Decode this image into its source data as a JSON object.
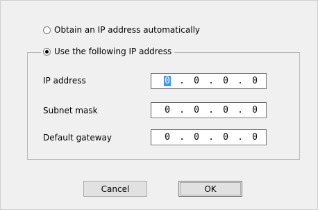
{
  "auto_option": {
    "label": "Obtain an IP address automatically",
    "selected": false
  },
  "manual_option": {
    "label": "Use the following IP address",
    "selected": true
  },
  "fields": {
    "ip_address": {
      "label": "IP address",
      "octets": [
        "0",
        "0",
        "0",
        "0"
      ]
    },
    "subnet_mask": {
      "label": "Subnet mask",
      "octets": [
        "0",
        "0",
        "0",
        "0"
      ]
    },
    "default_gateway": {
      "label": "Default gateway",
      "octets": [
        "0",
        "0",
        "0",
        "0"
      ]
    }
  },
  "buttons": {
    "cancel_label": "Cancel",
    "ok_label": "OK"
  }
}
